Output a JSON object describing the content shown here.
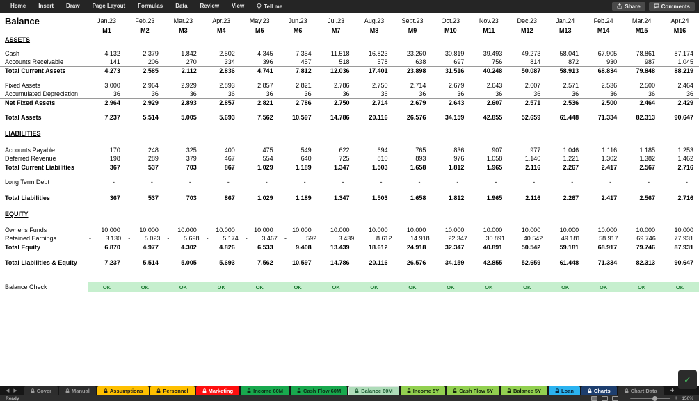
{
  "ribbon": {
    "menu_items": [
      "Home",
      "Insert",
      "Draw",
      "Page Layout",
      "Formulas",
      "Data",
      "Review",
      "View"
    ],
    "tell_me_label": "Tell me",
    "share_label": "Share",
    "comments_label": "Comments"
  },
  "sheet": {
    "title": "Balance",
    "columns": [
      {
        "month": "Jan.23",
        "code": "M1"
      },
      {
        "month": "Feb.23",
        "code": "M2"
      },
      {
        "month": "Mar.23",
        "code": "M3"
      },
      {
        "month": "Apr.23",
        "code": "M4"
      },
      {
        "month": "May.23",
        "code": "M5"
      },
      {
        "month": "Jun.23",
        "code": "M6"
      },
      {
        "month": "Jul.23",
        "code": "M7"
      },
      {
        "month": "Aug.23",
        "code": "M8"
      },
      {
        "month": "Sept.23",
        "code": "M9"
      },
      {
        "month": "Oct.23",
        "code": "M10"
      },
      {
        "month": "Nov.23",
        "code": "M11"
      },
      {
        "month": "Dec.23",
        "code": "M12"
      },
      {
        "month": "Jan.24",
        "code": "M13"
      },
      {
        "month": "Feb.24",
        "code": "M14"
      },
      {
        "month": "Mar.24",
        "code": "M15"
      },
      {
        "month": "Apr.24",
        "code": "M16"
      }
    ],
    "rows": [
      {
        "type": "section",
        "label": "ASSETS"
      },
      {
        "type": "spacer",
        "h": 8
      },
      {
        "type": "data",
        "label": "Cash",
        "values": [
          "4.132",
          "2.379",
          "1.842",
          "2.502",
          "4.345",
          "7.354",
          "11.518",
          "16.823",
          "23.260",
          "30.819",
          "39.493",
          "49.273",
          "58.041",
          "67.905",
          "78.861",
          "87.174"
        ]
      },
      {
        "type": "data",
        "label": "Accounts Receivable",
        "values": [
          "141",
          "206",
          "270",
          "334",
          "396",
          "457",
          "518",
          "578",
          "638",
          "697",
          "756",
          "814",
          "872",
          "930",
          "987",
          "1.045"
        ]
      },
      {
        "type": "total",
        "label": "Total Current Assets",
        "border_top": true,
        "values": [
          "4.273",
          "2.585",
          "2.112",
          "2.836",
          "4.741",
          "7.812",
          "12.036",
          "17.401",
          "23.898",
          "31.516",
          "40.248",
          "50.087",
          "58.913",
          "68.834",
          "79.848",
          "88.219"
        ]
      },
      {
        "type": "spacer",
        "h": 10
      },
      {
        "type": "data",
        "label": "Fixed Assets",
        "values": [
          "3.000",
          "2.964",
          "2.929",
          "2.893",
          "2.857",
          "2.821",
          "2.786",
          "2.750",
          "2.714",
          "2.679",
          "2.643",
          "2.607",
          "2.571",
          "2.536",
          "2.500",
          "2.464"
        ]
      },
      {
        "type": "data",
        "label": "Accumulated Depreciation",
        "values": [
          "36",
          "36",
          "36",
          "36",
          "36",
          "36",
          "36",
          "36",
          "36",
          "36",
          "36",
          "36",
          "36",
          "36",
          "36",
          "36"
        ]
      },
      {
        "type": "total",
        "label": "Net Fixed Assets",
        "border_top": true,
        "values": [
          "2.964",
          "2.929",
          "2.893",
          "2.857",
          "2.821",
          "2.786",
          "2.750",
          "2.714",
          "2.679",
          "2.643",
          "2.607",
          "2.571",
          "2.536",
          "2.500",
          "2.464",
          "2.429"
        ]
      },
      {
        "type": "spacer",
        "h": 10
      },
      {
        "type": "total",
        "label": "Total Assets",
        "values": [
          "7.237",
          "5.514",
          "5.005",
          "5.693",
          "7.562",
          "10.597",
          "14.786",
          "20.116",
          "26.576",
          "34.159",
          "42.855",
          "52.659",
          "61.448",
          "71.334",
          "82.313",
          "90.647"
        ]
      },
      {
        "type": "spacer",
        "h": 11
      },
      {
        "type": "section",
        "label": "LIABILITIES"
      },
      {
        "type": "spacer",
        "h": 12
      },
      {
        "type": "data",
        "label": "Accounts Payable",
        "values": [
          "170",
          "248",
          "325",
          "400",
          "475",
          "549",
          "622",
          "694",
          "765",
          "836",
          "907",
          "977",
          "1.046",
          "1.116",
          "1.185",
          "1.253"
        ]
      },
      {
        "type": "data",
        "label": "Deferred Revenue",
        "values": [
          "198",
          "289",
          "379",
          "467",
          "554",
          "640",
          "725",
          "810",
          "893",
          "976",
          "1.058",
          "1.140",
          "1.221",
          "1.302",
          "1.382",
          "1.462"
        ]
      },
      {
        "type": "total",
        "label": "Total Current Liabilities",
        "border_top": true,
        "values": [
          "367",
          "537",
          "703",
          "867",
          "1.029",
          "1.189",
          "1.347",
          "1.503",
          "1.658",
          "1.812",
          "1.965",
          "2.116",
          "2.267",
          "2.417",
          "2.567",
          "2.716"
        ]
      },
      {
        "type": "spacer",
        "h": 10
      },
      {
        "type": "data",
        "label": "Long Term Debt",
        "values": [
          "-",
          "-",
          "-",
          "-",
          "-",
          "-",
          "-",
          "-",
          "-",
          "-",
          "-",
          "-",
          "-",
          "-",
          "-",
          "-"
        ]
      },
      {
        "type": "spacer",
        "h": 11
      },
      {
        "type": "total",
        "label": "Total Liabilities",
        "values": [
          "367",
          "537",
          "703",
          "867",
          "1.029",
          "1.189",
          "1.347",
          "1.503",
          "1.658",
          "1.812",
          "1.965",
          "2.116",
          "2.267",
          "2.417",
          "2.567",
          "2.716"
        ]
      },
      {
        "type": "spacer",
        "h": 11
      },
      {
        "type": "section",
        "label": "EQUITY"
      },
      {
        "type": "spacer",
        "h": 11
      },
      {
        "type": "data",
        "label": "Owner's Funds",
        "values": [
          "10.000",
          "10.000",
          "10.000",
          "10.000",
          "10.000",
          "10.000",
          "10.000",
          "10.000",
          "10.000",
          "10.000",
          "10.000",
          "10.000",
          "10.000",
          "10.000",
          "10.000",
          "10.000"
        ]
      },
      {
        "type": "data",
        "label": "Retained Earnings",
        "values": [
          "- 3.130",
          "- 5.023",
          "- 5.698",
          "- 5.174",
          "- 3.467",
          "- 592",
          "3.439",
          "8.612",
          "14.918",
          "22.347",
          "30.891",
          "40.542",
          "49.181",
          "58.917",
          "69.746",
          "77.931"
        ]
      },
      {
        "type": "total",
        "label": "Total Equity",
        "border_top": true,
        "values": [
          "6.870",
          "4.977",
          "4.302",
          "4.826",
          "6.533",
          "9.408",
          "13.439",
          "18.612",
          "24.918",
          "32.347",
          "40.891",
          "50.542",
          "59.181",
          "68.917",
          "79.746",
          "87.931"
        ]
      },
      {
        "type": "spacer",
        "h": 11
      },
      {
        "type": "total",
        "label": "Total Liabilities & Equity",
        "values": [
          "7.237",
          "5.514",
          "5.005",
          "5.693",
          "7.562",
          "10.597",
          "14.786",
          "20.116",
          "26.576",
          "34.159",
          "42.855",
          "52.659",
          "61.448",
          "71.334",
          "82.313",
          "90.647"
        ]
      },
      {
        "type": "spacer",
        "h": 22
      },
      {
        "type": "check",
        "label": "Balance Check",
        "values": [
          "OK",
          "OK",
          "OK",
          "OK",
          "OK",
          "OK",
          "OK",
          "OK",
          "OK",
          "OK",
          "OK",
          "OK",
          "OK",
          "OK",
          "OK",
          "OK"
        ]
      }
    ]
  },
  "tabs": {
    "items": [
      {
        "label": "Cover",
        "style": "dark",
        "locked": true
      },
      {
        "label": "Manual",
        "style": "dark",
        "locked": true
      },
      {
        "label": "Assumptions",
        "style": "amber",
        "locked": true
      },
      {
        "label": "Personnel",
        "style": "amber",
        "locked": true
      },
      {
        "label": "Marketing",
        "style": "red",
        "locked": true
      },
      {
        "label": "Income 60M",
        "style": "green",
        "locked": true
      },
      {
        "label": "Cash Flow 60M",
        "style": "green",
        "locked": true
      },
      {
        "label": "Balance 60M",
        "style": "pale",
        "locked": true,
        "active": true
      },
      {
        "label": "Income 5Y",
        "style": "lime",
        "locked": true
      },
      {
        "label": "Cash Flow 5Y",
        "style": "lime",
        "locked": true
      },
      {
        "label": "Balance 5Y",
        "style": "lime",
        "locked": true
      },
      {
        "label": "Loan",
        "style": "blue",
        "locked": true
      },
      {
        "label": "Charts",
        "style": "navy",
        "locked": true
      },
      {
        "label": "Chart Data",
        "style": "dark",
        "locked": true
      }
    ],
    "add_label": "+"
  },
  "status": {
    "ready_label": "Ready",
    "zoom_level": "150%"
  },
  "colors": {
    "check_bg": "#C6EFCE",
    "check_text": "#1E7B34",
    "tab_styles": {
      "dark": {
        "bg": "#2d2d2d",
        "fg": "#9e9e9e"
      },
      "amber": {
        "bg": "#FFC000",
        "fg": "#1a1a1a"
      },
      "red": {
        "bg": "#FF0F0F",
        "fg": "#ffffff"
      },
      "green": {
        "bg": "#18A94E",
        "fg": "#0c2a14"
      },
      "pale": {
        "bg": "#AEDCB9",
        "fg": "#1d5c33"
      },
      "lime": {
        "bg": "#92D050",
        "fg": "#13240a"
      },
      "blue": {
        "bg": "#2BB3F0",
        "fg": "#08263b"
      },
      "navy": {
        "bg": "#1D3E6E",
        "fg": "#ffffff"
      }
    }
  }
}
